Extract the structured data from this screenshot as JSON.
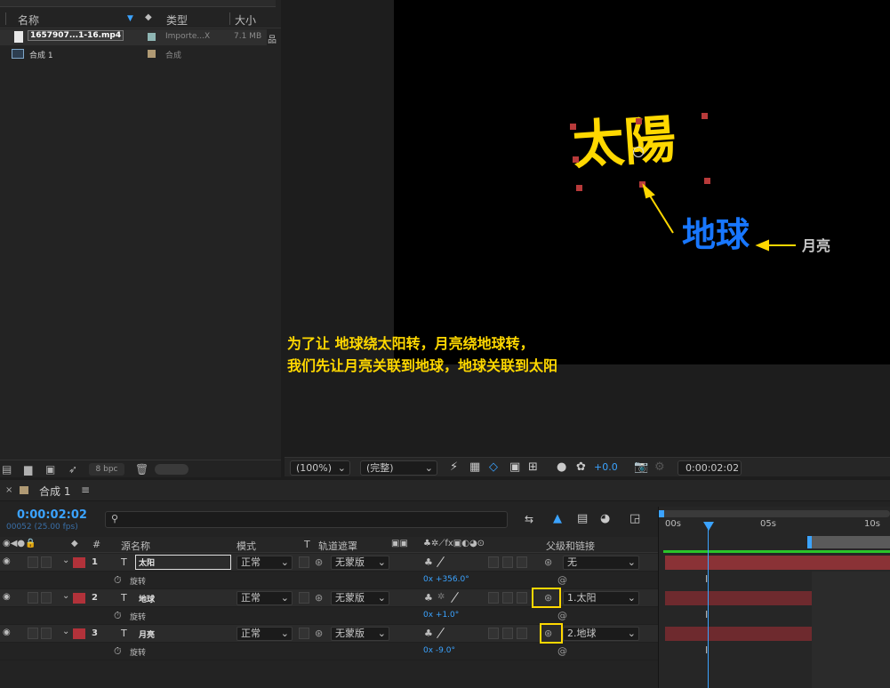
{
  "project_panel": {
    "columns": {
      "name": "名称",
      "type": "类型",
      "size": "大小"
    },
    "items": [
      {
        "name": "1657907...1-16.mp4",
        "type": "Importe...X",
        "size": "7.1 MB",
        "swatch": "#8fb6b4"
      },
      {
        "name": "合成 1",
        "type": "合成",
        "size": "",
        "swatch": "#b09a74"
      }
    ],
    "bpc": "8 bpc"
  },
  "viewer": {
    "canvas_text": {
      "sun": "太陽",
      "earth": "地球",
      "moon": "月亮"
    },
    "annotation_line1": "为了让 地球绕太阳转，月亮绕地球转，",
    "annotation_line2": "我们先让月亮关联到地球，地球关联到太阳",
    "zoom": "(100%)",
    "resolution": "(完整)",
    "exposure": "+0.0",
    "timecode": "0:00:02:02"
  },
  "timeline": {
    "tab": "合成 1",
    "timecode": "0:00:02:02",
    "frames": "00052 (25.00 fps)",
    "columns": {
      "num": "#",
      "source": "源名称",
      "mode": "模式",
      "t": "T",
      "track": "轨道遮罩",
      "parent": "父级和链接"
    },
    "layers": [
      {
        "num": "1",
        "name": "太阳",
        "mode": "正常",
        "track": "无蒙版",
        "parent": "无",
        "prop": "旋转",
        "value": "0x +356.0°"
      },
      {
        "num": "2",
        "name": "地球",
        "mode": "正常",
        "track": "无蒙版",
        "parent": "1.太阳",
        "prop": "旋转",
        "value": "0x +1.0°"
      },
      {
        "num": "3",
        "name": "月亮",
        "mode": "正常",
        "track": "无蒙版",
        "parent": "2.地球",
        "prop": "旋转",
        "value": "0x -9.0°"
      }
    ],
    "ruler": [
      "00s",
      "05s",
      "10s"
    ]
  },
  "colors": {
    "accent": "#3ba3ff",
    "label_red": "#b2323a",
    "sun": "#ffd800",
    "earth": "#1877ff",
    "annotation": "#ffd800"
  }
}
